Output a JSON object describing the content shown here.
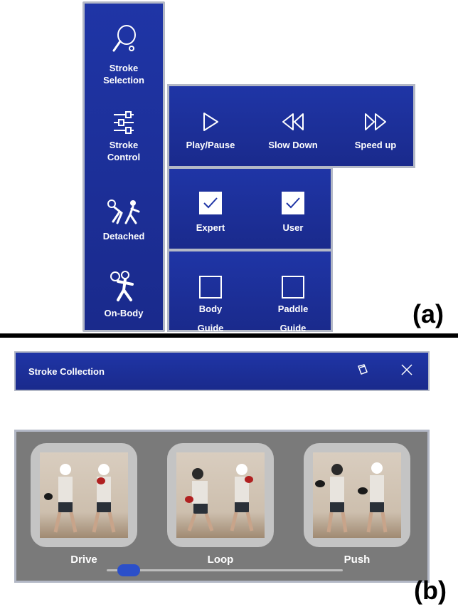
{
  "figure_labels": {
    "a": "(a)",
    "b": "(b)"
  },
  "sidebar": {
    "items": [
      {
        "line1": "Stroke",
        "line2": "Selection",
        "icon": "paddle-icon"
      },
      {
        "line1": "Stroke",
        "line2": "Control",
        "icon": "sliders-icon"
      },
      {
        "line1": "Detached",
        "icon": "detached-players-icon"
      },
      {
        "line1": "On-Body",
        "icon": "on-body-player-icon"
      }
    ]
  },
  "playback": {
    "play_pause": "Play/Pause",
    "slow_down": "Slow Down",
    "speed_up": "Speed up"
  },
  "views": {
    "expert": {
      "label": "Expert",
      "checked": true
    },
    "user": {
      "label": "User",
      "checked": true
    }
  },
  "guides": {
    "body": {
      "line1": "Body",
      "line2": "Guide",
      "checked": false
    },
    "paddle": {
      "line1": "Paddle",
      "line2": "Guide",
      "checked": false
    }
  },
  "collection": {
    "title": "Stroke Collection",
    "strokes": [
      {
        "label": "Drive"
      },
      {
        "label": "Loop"
      },
      {
        "label": "Push"
      }
    ],
    "scroll_position": 0.05
  },
  "colors": {
    "panel": "#1f35a6",
    "border": "#b3b8c6",
    "gallery": "#7a7a7a",
    "accent": "#2b4fc9"
  }
}
